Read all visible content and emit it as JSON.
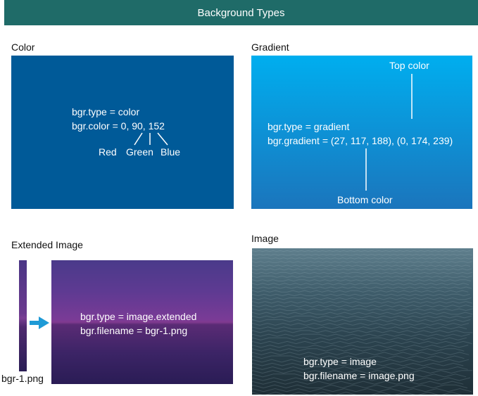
{
  "header": {
    "title": "Background Types"
  },
  "color_panel": {
    "title": "Color",
    "fill": "#005a98",
    "code_line1": "bgr.type = color",
    "code_line2": "bgr.color = 0, 90, 152",
    "labels": {
      "red": "Red",
      "green": "Green",
      "blue": "Blue"
    }
  },
  "gradient_panel": {
    "title": "Gradient",
    "top_color": "#00aeef",
    "bottom_color": "#1b75bc",
    "code_line1": "bgr.type = gradient",
    "code_line2": "bgr.gradient = (27, 117, 188), (0, 174, 239)",
    "top_label": "Top color",
    "bottom_label": "Bottom color"
  },
  "extended_panel": {
    "title": "Extended Image",
    "code_line1": "bgr.type = image.extended",
    "code_line2": "bgr.filename = bgr-1.png",
    "source_label": "bgr-1.png",
    "arrow_color": "#1e9ad6",
    "arrow_icon": "arrow-right-icon"
  },
  "image_panel": {
    "title": "Image",
    "code_line1": "bgr.type = image",
    "code_line2": "bgr.filename = image.png"
  }
}
